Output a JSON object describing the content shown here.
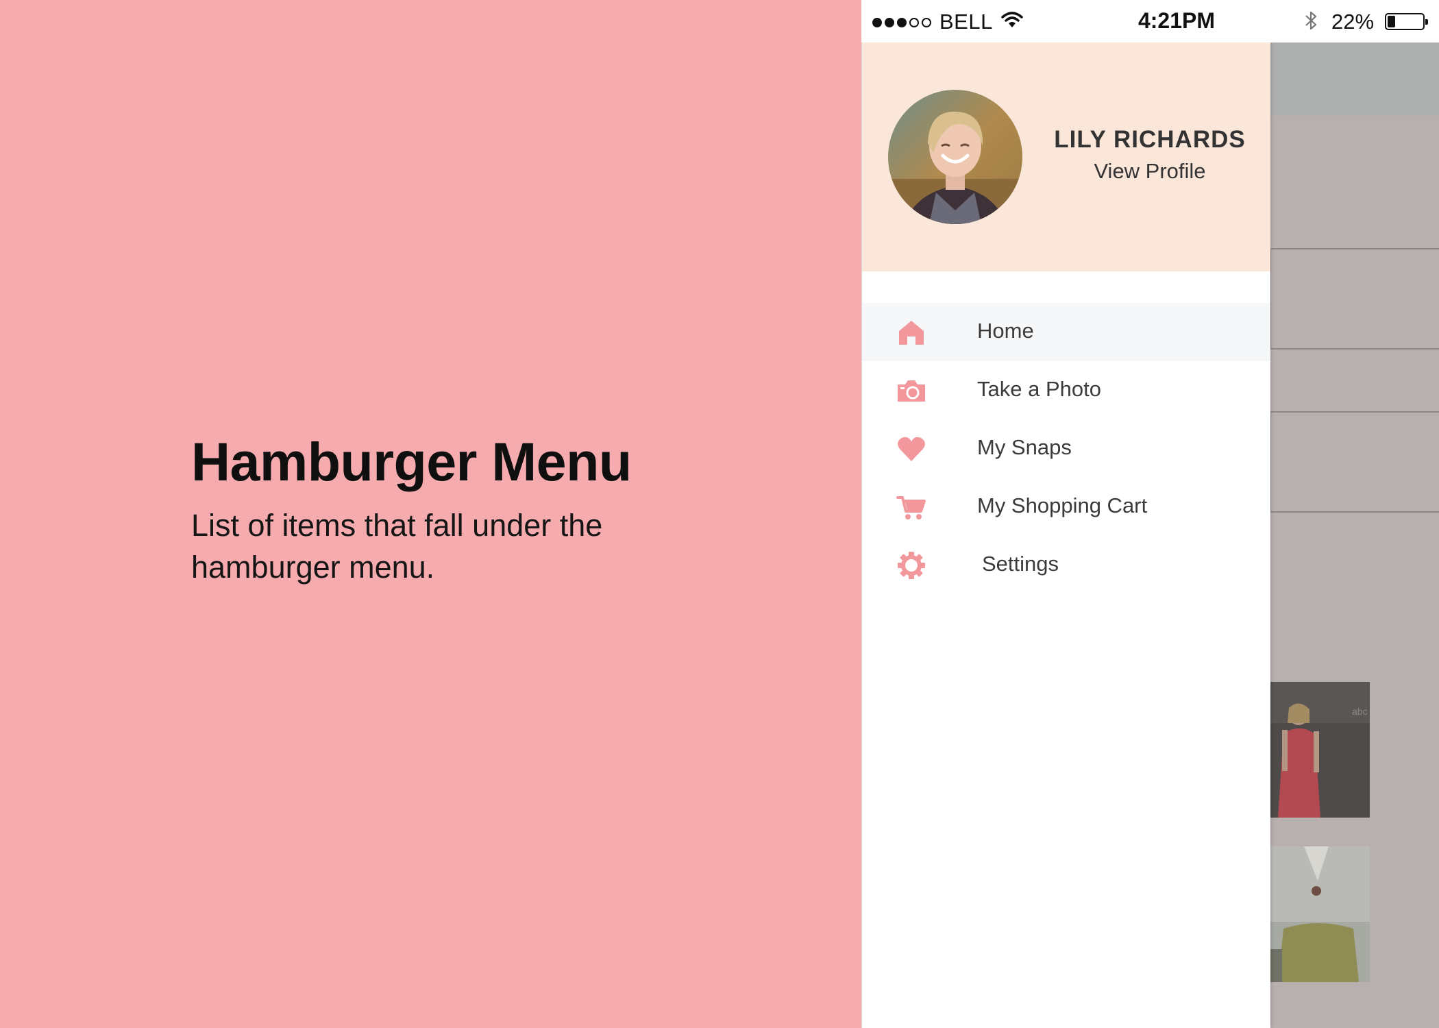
{
  "caption": {
    "title": "Hamburger Menu",
    "subtitle": "List of items that fall under the hamburger menu."
  },
  "status_bar": {
    "carrier": "BELL",
    "time": "4:21PM",
    "battery_text": "22%",
    "battery_level": 0.22,
    "signal_bars_filled": 3,
    "signal_bars_total": 5
  },
  "drawer": {
    "user_name": "LILY RICHARDS",
    "profile_link": "View Profile",
    "accent_color": "#f2989c",
    "header_color": "#fbe6da",
    "items": [
      {
        "label": "Home",
        "icon": "home-icon",
        "active": true
      },
      {
        "label": "Take a Photo",
        "icon": "camera-icon",
        "active": false
      },
      {
        "label": "My Snaps",
        "icon": "heart-icon",
        "active": false
      },
      {
        "label": "My Shopping Cart",
        "icon": "cart-icon",
        "active": false
      },
      {
        "label": "Settings",
        "icon": "gear-icon",
        "active": false
      }
    ]
  }
}
